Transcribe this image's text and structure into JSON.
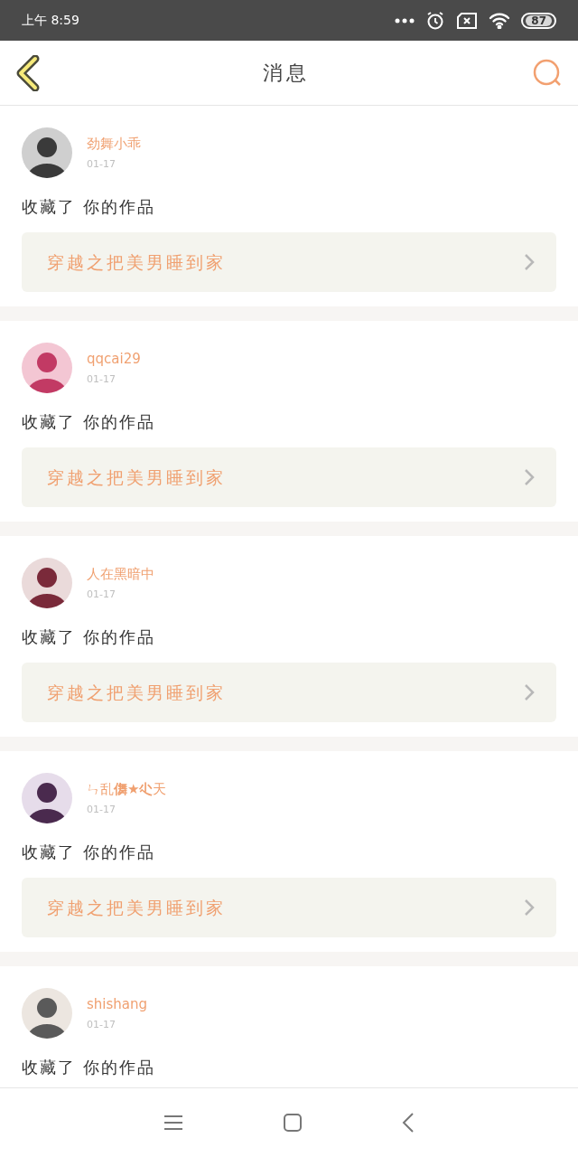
{
  "status_bar": {
    "time": "上午 8:59",
    "battery": "87"
  },
  "header": {
    "title": "消息"
  },
  "messages": [
    {
      "user": "劲舞小乖",
      "date": "01-17",
      "action": "收藏了 你的作品",
      "work": "穿越之把美男睡到家"
    },
    {
      "user": "qqcai29",
      "date": "01-17",
      "action": "收藏了 你的作品",
      "work": "穿越之把美男睡到家"
    },
    {
      "user": "人在黑暗中",
      "date": "01-17",
      "action": "收藏了 你的作品",
      "work": "穿越之把美男睡到家"
    },
    {
      "user": "ㄣ乱**儛★尐**天",
      "date": "01-17",
      "action": "收藏了 你的作品",
      "work": "穿越之把美男睡到家"
    },
    {
      "user": "shishang",
      "date": "01-17",
      "action": "收藏了 你的作品"
    }
  ]
}
